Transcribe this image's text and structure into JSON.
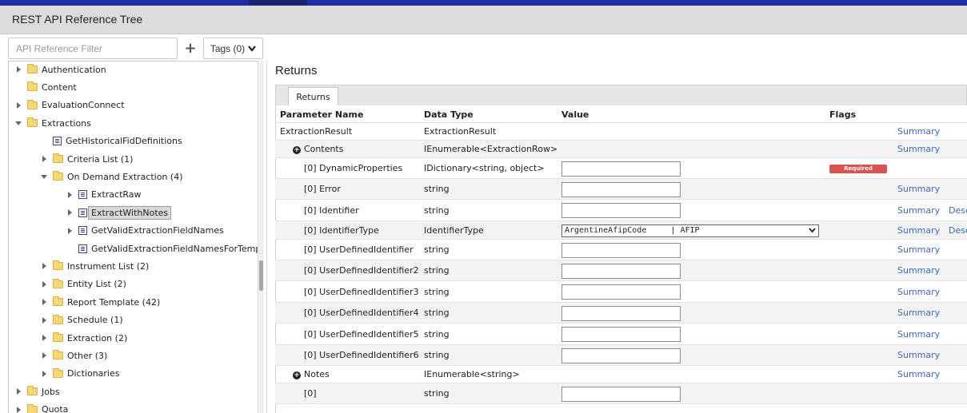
{
  "header": {
    "title": "REST API Reference Tree"
  },
  "filter": {
    "placeholder": "API Reference Filter",
    "add_icon": "plus-icon",
    "tags_label": "Tags (0)"
  },
  "tree": [
    {
      "label": "Authentication",
      "kind": "folder",
      "arrow": "right",
      "level": 0
    },
    {
      "label": "Content",
      "kind": "folder",
      "arrow": "none",
      "level": 0
    },
    {
      "label": "EvaluationConnect",
      "kind": "folder",
      "arrow": "right",
      "level": 0
    },
    {
      "label": "Extractions",
      "kind": "folder",
      "arrow": "down",
      "level": 0
    },
    {
      "label": "GetHistoricalFidDefinitions",
      "kind": "endpoint",
      "arrow": "none",
      "level": 1
    },
    {
      "label": "Criteria List (1)",
      "kind": "folder",
      "arrow": "right",
      "level": 1
    },
    {
      "label": "On Demand Extraction (4)",
      "kind": "folder",
      "arrow": "down",
      "level": 1
    },
    {
      "label": "ExtractRaw",
      "kind": "endpoint",
      "arrow": "right",
      "level": 2
    },
    {
      "label": "ExtractWithNotes",
      "kind": "endpoint",
      "arrow": "right",
      "level": 2,
      "selected": true
    },
    {
      "label": "GetValidExtractionFieldNames",
      "kind": "endpoint",
      "arrow": "right",
      "level": 2
    },
    {
      "label": "GetValidExtractionFieldNamesForTemplate",
      "kind": "endpoint",
      "arrow": "none",
      "level": 2
    },
    {
      "label": "Instrument List (2)",
      "kind": "folder",
      "arrow": "right",
      "level": 1
    },
    {
      "label": "Entity List (2)",
      "kind": "folder",
      "arrow": "right",
      "level": 1
    },
    {
      "label": "Report Template (42)",
      "kind": "folder",
      "arrow": "right",
      "level": 1
    },
    {
      "label": "Schedule (1)",
      "kind": "folder",
      "arrow": "right",
      "level": 1
    },
    {
      "label": "Extraction (2)",
      "kind": "folder",
      "arrow": "right",
      "level": 1
    },
    {
      "label": "Other (3)",
      "kind": "folder",
      "arrow": "right",
      "level": 1
    },
    {
      "label": "Dictionaries",
      "kind": "folder",
      "arrow": "right",
      "level": 1
    },
    {
      "label": "Jobs",
      "kind": "folder",
      "arrow": "right",
      "level": 0
    },
    {
      "label": "Quota",
      "kind": "folder",
      "arrow": "right",
      "level": 0
    }
  ],
  "main": {
    "heading": "Returns",
    "tab": "Returns",
    "columns": [
      "Parameter Name",
      "Data Type",
      "Value",
      "Flags"
    ],
    "rows": [
      {
        "name": "ExtractionResult",
        "type": "ExtractionResult",
        "summary": "Summary",
        "indent": 0
      },
      {
        "name": "Contents",
        "type": "IEnumerable<ExtractionRow>",
        "summary": "Summary",
        "indent": 1,
        "expand": true
      },
      {
        "name": "[0] DynamicProperties",
        "type": "IDictionary<string, object>",
        "input": true,
        "flag": "Required",
        "indent": 2
      },
      {
        "name": "[0] Error",
        "type": "string",
        "input": true,
        "summary": "Summary",
        "indent": 2
      },
      {
        "name": "[0] Identifier",
        "type": "string",
        "input": true,
        "summary": "Summary",
        "desc": "Desc",
        "indent": 2
      },
      {
        "name": "[0] IdentifierType",
        "type": "IdentifierType",
        "select": "ArgentineAfipCode     | AFIP",
        "summary": "Summary",
        "desc": "Desc",
        "indent": 2
      },
      {
        "name": "[0] UserDefinedIdentifier",
        "type": "string",
        "input": true,
        "summary": "Summary",
        "indent": 2
      },
      {
        "name": "[0] UserDefinedIdentifier2",
        "type": "string",
        "input": true,
        "summary": "Summary",
        "indent": 2
      },
      {
        "name": "[0] UserDefinedIdentifier3",
        "type": "string",
        "input": true,
        "summary": "Summary",
        "indent": 2
      },
      {
        "name": "[0] UserDefinedIdentifier4",
        "type": "string",
        "input": true,
        "summary": "Summary",
        "indent": 2
      },
      {
        "name": "[0] UserDefinedIdentifier5",
        "type": "string",
        "input": true,
        "summary": "Summary",
        "indent": 2
      },
      {
        "name": "[0] UserDefinedIdentifier6",
        "type": "string",
        "input": true,
        "summary": "Summary",
        "indent": 2
      },
      {
        "name": "Notes",
        "type": "IEnumerable<string>",
        "summary": "Summary",
        "indent": 1,
        "expand": true
      },
      {
        "name": "[0]",
        "type": "string",
        "input": true,
        "indent": 2
      }
    ]
  }
}
